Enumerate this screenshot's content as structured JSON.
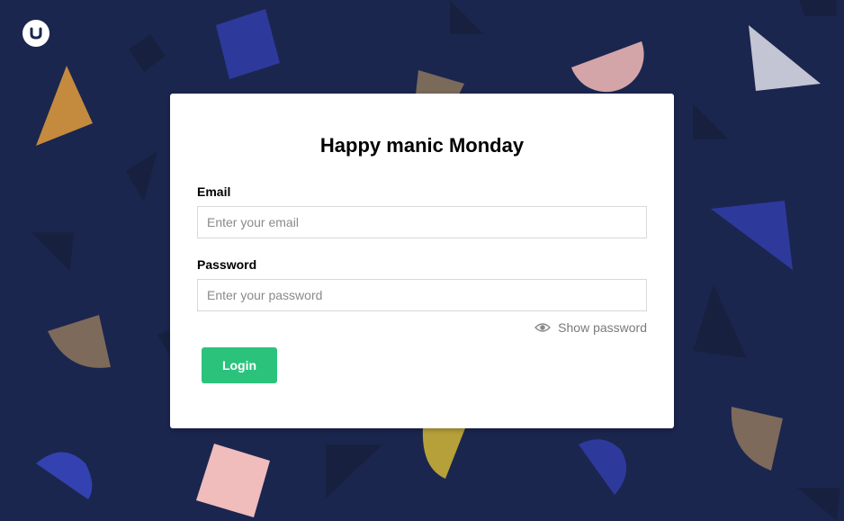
{
  "app": {
    "logo_icon": "umbraco-logo-icon"
  },
  "login_card": {
    "title": "Happy manic Monday",
    "email": {
      "label": "Email",
      "placeholder": "Enter your email",
      "value": ""
    },
    "password": {
      "label": "Password",
      "placeholder": "Enter your password",
      "value": ""
    },
    "show_password": {
      "label": "Show password",
      "icon": "eye-icon"
    },
    "login_button": {
      "label": "Login"
    }
  },
  "colors": {
    "background": "#1b264f",
    "card": "#ffffff",
    "login_button": "#2bc37c",
    "input_border": "#d8d7d9",
    "muted_text": "#7a7a7a"
  }
}
